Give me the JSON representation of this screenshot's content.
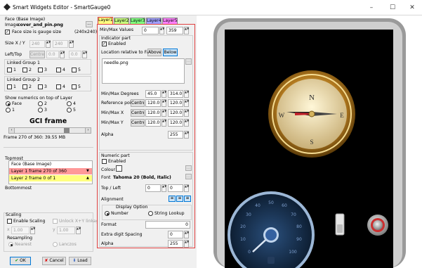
{
  "window": {
    "title": "Smart Widgets Editor - SmartGauge0",
    "minimize": "–",
    "maximize": "☐",
    "close": "✕"
  },
  "left": {
    "face_header": "Face (Base Image)",
    "image_label": "Image",
    "image_value": "cover_and_pin.png",
    "browse": "...",
    "face_size_label": "Face size is gauge size",
    "face_size_value": "(240x240)",
    "size_label": "Size X / Y",
    "size_x": "240",
    "size_y": "240",
    "lefttop_label": "Left/Top",
    "centre": "Centre",
    "left_val": "0.0",
    "top_val": "0.0",
    "linked1": "Linked Group 1",
    "linked2": "Linked Group 2",
    "link_nums": [
      "1",
      "2",
      "3",
      "4",
      "5"
    ],
    "show_numerics": "Show numerics on top of Layer",
    "radio_face": "Face",
    "r2": "2",
    "r4": "4",
    "r1": "1",
    "r3": "3",
    "r5": "5",
    "gci_title": "GCI frame",
    "frame_info": "Frame 270 of 360: 39.55 MB",
    "topmost": "Topmost",
    "layer_items": [
      "Face (Base Image)",
      "Layer 1 frame 270 of 360",
      "Layer 2 frame 0 of 1"
    ],
    "bottommost": "Bottommost",
    "scaling": "Scaling",
    "enable_scaling": "Enable Scaling",
    "unlock": "Unlock X+Y linkage",
    "scale_x": "1.00",
    "scale_y": "1.00",
    "resampling": "Resampling",
    "nearest": "Nearest",
    "lanczos": "Lanczos",
    "ok": "OK",
    "cancel": "Cancel",
    "load": "Load"
  },
  "tabs": [
    {
      "label": "Layer1",
      "color": "#ffff80"
    },
    {
      "label": "Layer2",
      "color": "#c8ff80"
    },
    {
      "label": "Layer3",
      "color": "#80ff80"
    },
    {
      "label": "Layer4",
      "color": "#a0a0ff"
    },
    {
      "label": "Layer5",
      "color": "#ff80ff"
    }
  ],
  "mid": {
    "minmax_values": "Min/Max Values",
    "min_val": "0",
    "max_val": "359",
    "indicator_part": "Indicator part",
    "enabled": "Enabled",
    "loc_rel": "Location relative to Face",
    "above": "Above",
    "below": "Below",
    "file": "needle.png",
    "browse": "...",
    "minmax_deg": "Min/Max Degrees",
    "deg_min": "45.0",
    "deg_max": "314.0",
    "ref_point": "Reference point",
    "centre": "Centre",
    "ref_x": "120.0",
    "ref_y": "120.0",
    "minmax_x": "Min/Max X",
    "mx_min": "120.0",
    "mx_max": "120.0",
    "minmax_y": "Min/Max Y",
    "my_min": "120.0",
    "my_max": "120.0",
    "alpha": "Alpha",
    "alpha_val": "255",
    "numeric_part": "Numeric part",
    "enabled2": "Enabled",
    "colour": "Colour",
    "font_label": "Font",
    "font_value": "Tahoma 20 (Bold, Italic)",
    "top_left": "Top / Left",
    "top_val": "0",
    "left_val": "0",
    "alignment": "Alignment",
    "align_l": "≡",
    "align_c": "≡",
    "align_r": "≡",
    "display_option": "Display Option",
    "number": "Number",
    "string_lookup": "String Lookup",
    "format": "Format",
    "format_val": "0",
    "extra_digit": "Extra digit Spacing",
    "extra_val": "0",
    "alpha2": "Alpha",
    "alpha2_val": "255"
  },
  "preview": {
    "gauge_numbers": [
      "0",
      "10",
      "20",
      "30",
      "40",
      "50",
      "60",
      "70",
      "80",
      "90",
      "100"
    ],
    "compass_letters": [
      "N",
      "E",
      "S",
      "W"
    ],
    "home": "▯"
  }
}
